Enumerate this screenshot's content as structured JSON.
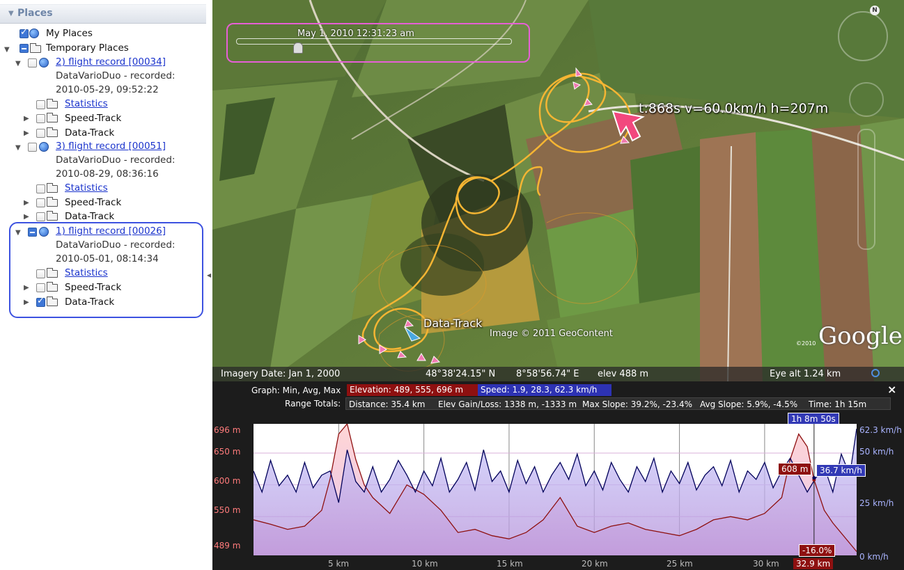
{
  "sidebar": {
    "header": "Places",
    "tree": {
      "my_places": "My Places",
      "temporary_places": "Temporary Places",
      "records": [
        {
          "title": "2) flight record [00034]",
          "desc1": "DataVarioDuo - recorded:",
          "desc2": "2010-05-29, 09:52:22",
          "statistics": "Statistics",
          "speed": "Speed-Track",
          "data": "Data-Track"
        },
        {
          "title": "3) flight record [00051]",
          "desc1": "DataVarioDuo - recorded:",
          "desc2": "2010-08-29, 08:36:16",
          "statistics": "Statistics",
          "speed": "Speed-Track",
          "data": "Data-Track"
        },
        {
          "title": "1) flight record [00026]",
          "desc1": "DataVarioDuo - recorded:",
          "desc2": "2010-05-01, 08:14:34",
          "statistics": "Statistics",
          "speed": "Speed-Track",
          "data": "Data-Track"
        }
      ]
    }
  },
  "map": {
    "time_label": "May  1, 2010  12:31:23 am",
    "overlay_stats": "t:868s   v=60.0km/h   h=207m",
    "track_label": "Data-Track",
    "image_credit": "Image © 2011 GeoContent",
    "logo": "Google",
    "logo_year": "©2010",
    "compass_letter": "N",
    "status": {
      "imagery_date": "Imagery Date: Jan  1, 2000",
      "lat": "48°38'24.15\" N",
      "lon": "8°58'56.74\" E",
      "elev": "elev  488 m",
      "eye_alt": "Eye alt    1.24 km"
    }
  },
  "graph": {
    "minavgmax_label": "Graph: Min, Avg, Max",
    "elevation_summary": "Elevation: 489, 555, 696 m",
    "speed_summary": "Speed: 1.9, 28.3, 62.3 km/h",
    "range_totals_label": "Range Totals:",
    "distance": "Distance: 35.4 km",
    "elev_gain": "Elev Gain/Loss: 1338 m, -1333 m",
    "max_slope": "Max Slope: 39.2%, -23.4%",
    "avg_slope": "Avg Slope: 5.9%, -4.5%",
    "time": "Time: 1h 15m",
    "close": "×",
    "time_cursor": "1h 8m 50s",
    "elev_cursor": "608 m",
    "speed_cursor": "36.7 km/h",
    "slope_cursor": "-16.0%",
    "dist_cursor": "32.9 km",
    "y_left": [
      "696 m",
      "650 m",
      "600 m",
      "550 m",
      "489 m"
    ],
    "y_right": [
      "62.3 km/h",
      "50 km/h",
      "25 km/h",
      "0 km/h"
    ],
    "x_ticks": [
      "5 km",
      "10 km",
      "15 km",
      "20 km",
      "25 km",
      "30 km"
    ]
  },
  "chart_data": {
    "type": "line",
    "x_unit": "km",
    "xlim": [
      0,
      35.4
    ],
    "series": [
      {
        "name": "Elevation",
        "unit": "m",
        "ylim": [
          489,
          696
        ],
        "color": "#8e1010",
        "x": [
          0,
          1,
          2,
          3,
          4,
          4.5,
          5,
          5.5,
          6,
          6.5,
          7,
          8,
          9,
          10,
          11,
          12,
          13,
          14,
          15,
          16,
          17,
          18,
          19,
          20,
          21,
          22,
          23,
          24,
          25,
          26,
          27,
          28,
          29,
          30,
          31,
          31.5,
          32,
          32.5,
          32.9,
          33.5,
          34,
          35.4
        ],
        "values": [
          545,
          538,
          530,
          535,
          560,
          610,
          680,
          696,
          640,
          600,
          580,
          555,
          600,
          585,
          560,
          525,
          530,
          520,
          515,
          525,
          545,
          580,
          535,
          525,
          535,
          540,
          530,
          525,
          520,
          530,
          545,
          550,
          545,
          555,
          580,
          640,
          680,
          660,
          608,
          560,
          540,
          495
        ]
      },
      {
        "name": "Speed",
        "unit": "km/h",
        "ylim": [
          0,
          62.3
        ],
        "color": "#00005a",
        "x": [
          0,
          0.5,
          1,
          1.5,
          2,
          2.5,
          3,
          3.5,
          4,
          4.5,
          5,
          5.5,
          6,
          6.5,
          7,
          7.5,
          8,
          8.5,
          9,
          9.5,
          10,
          10.5,
          11,
          11.5,
          12,
          12.5,
          13,
          13.5,
          14,
          14.5,
          15,
          15.5,
          16,
          16.5,
          17,
          17.5,
          18,
          18.5,
          19,
          19.5,
          20,
          20.5,
          21,
          21.5,
          22,
          22.5,
          23,
          23.5,
          24,
          24.5,
          25,
          25.5,
          26,
          26.5,
          27,
          27.5,
          28,
          28.5,
          29,
          29.5,
          30,
          30.5,
          31,
          31.5,
          32,
          32.5,
          33,
          33.5,
          34,
          34.5,
          35,
          35.4
        ],
        "values": [
          40,
          30,
          45,
          33,
          38,
          30,
          44,
          32,
          38,
          40,
          25,
          50,
          35,
          30,
          42,
          30,
          36,
          45,
          38,
          30,
          40,
          33,
          46,
          30,
          36,
          44,
          31,
          50,
          35,
          40,
          30,
          45,
          34,
          42,
          30,
          38,
          44,
          36,
          48,
          33,
          40,
          31,
          44,
          36,
          30,
          42,
          35,
          46,
          30,
          40,
          34,
          44,
          31,
          38,
          42,
          33,
          45,
          30,
          40,
          36,
          44,
          32,
          40,
          46,
          38,
          30,
          36.7,
          42,
          30,
          48,
          38,
          60
        ]
      }
    ],
    "cursor": {
      "x": 32.9,
      "elevation": 608,
      "speed": 36.7,
      "slope": "-16.0%",
      "time": "1h 8m 50s"
    }
  }
}
